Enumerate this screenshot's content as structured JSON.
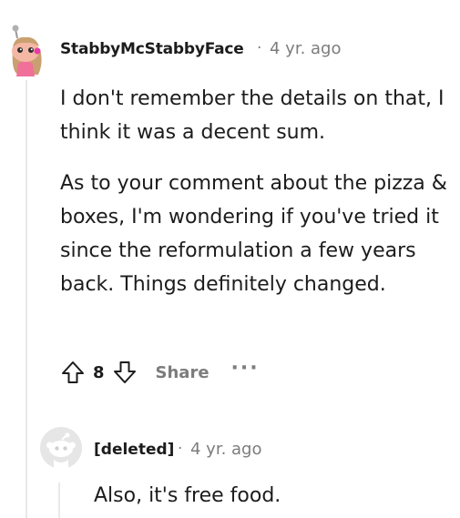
{
  "comment": {
    "author": "StabbyMcStabbyFace",
    "separator": "·",
    "time": "4 yr. ago",
    "paragraphs": [
      "I don't remember the details on that, I think it was a decent sum.",
      "As to your comment about the pizza & boxes, I'm wondering if you've tried it since the reformulation a few years back. Things definitely changed."
    ],
    "votes": "8",
    "share_label": "Share",
    "more_label": "···"
  },
  "reply": {
    "author": "[deleted]",
    "separator": "·",
    "time": "4 yr. ago",
    "text": "Also, it's free food."
  },
  "colors": {
    "meta": "#7c7c7c",
    "text": "#1c1c1c",
    "thread": "#e9e9e9"
  }
}
